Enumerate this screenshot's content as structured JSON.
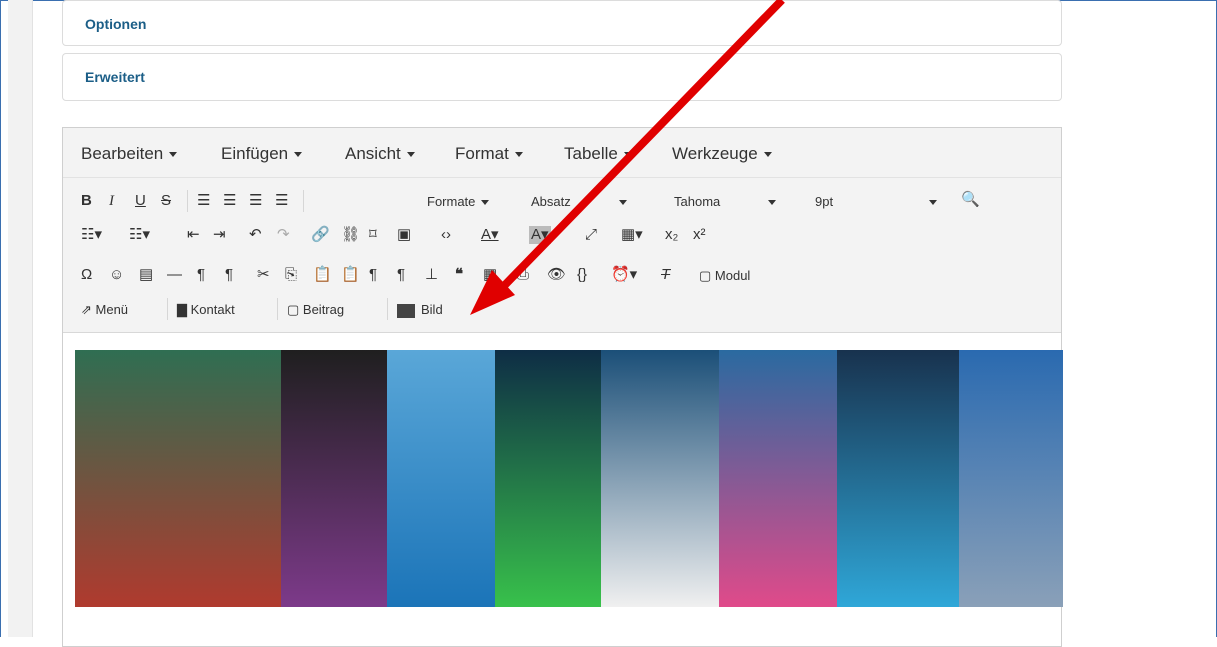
{
  "panels": [
    {
      "label": "Optionen"
    },
    {
      "label": "Erweitert"
    }
  ],
  "menubar": {
    "items": [
      "Bearbeiten",
      "Einfügen",
      "Ansicht",
      "Format",
      "Tabelle",
      "Werkzeuge"
    ]
  },
  "toolbar": {
    "formats_label": "Formate",
    "paragraph_label": "Absatz",
    "font_label": "Tahoma",
    "size_label": "9pt",
    "module_label": "Modul"
  },
  "buttons": {
    "menu": "Menü",
    "contact": "Kontakt",
    "article": "Beitrag",
    "image": "Bild"
  },
  "colors": {
    "accent_link": "#1b5e87",
    "arrow": "#e00000",
    "toolbar_bg": "#f3f3f3"
  }
}
